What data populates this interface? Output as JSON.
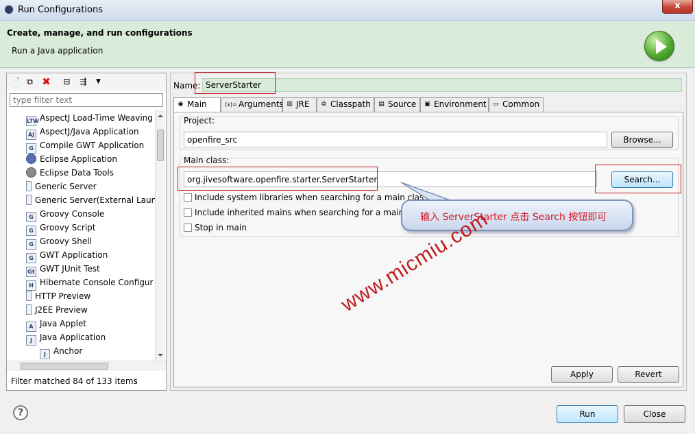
{
  "window": {
    "title": "Run Configurations",
    "close_glyph": "x"
  },
  "banner": {
    "title": "Create, manage, and run configurations",
    "subtitle": "Run a Java application",
    "icon": "run-icon"
  },
  "left": {
    "filter_placeholder": "type filter text",
    "toolbar_icons": [
      "new-config-icon",
      "duplicate-icon",
      "delete-icon",
      "collapse-all-icon",
      "filter-icon",
      "dropdown-icon"
    ],
    "items": [
      {
        "label": "AspectJ Load-Time Weaving",
        "icon": "ltw-icon",
        "badge": "LTW"
      },
      {
        "label": "AspectJ/Java Application",
        "icon": "aj-icon",
        "badge": "AJ"
      },
      {
        "label": "Compile GWT Application",
        "icon": "gwt-compile-icon",
        "badge": "G"
      },
      {
        "label": "Eclipse Application",
        "icon": "eclipse-icon",
        "badge": ""
      },
      {
        "label": "Eclipse Data Tools",
        "icon": "data-tools-icon",
        "badge": ""
      },
      {
        "label": "Generic Server",
        "icon": "server-icon",
        "badge": ""
      },
      {
        "label": "Generic Server(External Laun",
        "icon": "server-icon",
        "badge": ""
      },
      {
        "label": "Groovy Console",
        "icon": "groovy-icon",
        "badge": "G"
      },
      {
        "label": "Groovy Script",
        "icon": "groovy-icon",
        "badge": "G"
      },
      {
        "label": "Groovy Shell",
        "icon": "groovy-icon",
        "badge": "G"
      },
      {
        "label": "GWT Application",
        "icon": "gwt-icon",
        "badge": "G"
      },
      {
        "label": "GWT JUnit Test",
        "icon": "gwt-junit-icon",
        "badge": "Gt"
      },
      {
        "label": "Hibernate Console Configur",
        "icon": "hibernate-icon",
        "badge": "H"
      },
      {
        "label": "HTTP Preview",
        "icon": "server-icon",
        "badge": ""
      },
      {
        "label": "J2EE Preview",
        "icon": "server-icon",
        "badge": ""
      },
      {
        "label": "Java Applet",
        "icon": "applet-icon",
        "badge": "A"
      },
      {
        "label": "Java Application",
        "icon": "java-app-icon",
        "badge": "J"
      },
      {
        "label": "Anchor",
        "icon": "java-config-icon",
        "badge": "J"
      }
    ],
    "status": "Filter matched 84 of 133 items"
  },
  "right": {
    "name_label": "Name:",
    "name_value": "ServerStarter",
    "tabs": [
      {
        "label": "Main",
        "icon": "main-tab-icon",
        "glyph": "◉"
      },
      {
        "label": "Arguments",
        "icon": "arguments-tab-icon",
        "glyph": "(x)="
      },
      {
        "label": "JRE",
        "icon": "jre-tab-icon",
        "glyph": "▥"
      },
      {
        "label": "Classpath",
        "icon": "classpath-tab-icon",
        "glyph": "⧉"
      },
      {
        "label": "Source",
        "icon": "source-tab-icon",
        "glyph": "▤"
      },
      {
        "label": "Environment",
        "icon": "environment-tab-icon",
        "glyph": "▣"
      },
      {
        "label": "Common",
        "icon": "common-tab-icon",
        "glyph": "▭"
      }
    ],
    "project_label": "Project:",
    "project_value": "openfire_src",
    "browse_label": "Browse...",
    "main_class_label": "Main class:",
    "main_class_value": "org.jivesoftware.openfire.starter.ServerStarter",
    "search_label": "Search...",
    "checkboxes": [
      {
        "label": "Include system libraries when searching for a main class",
        "checked": false
      },
      {
        "label": "Include inherited mains when searching for a main class",
        "checked": false
      },
      {
        "label": "Stop in main",
        "checked": false
      }
    ],
    "apply_label": "Apply",
    "revert_label": "Revert"
  },
  "annotation": {
    "callout": "输入 ServerStarter 点击 Search 按钮即可",
    "watermark": "www.micmiu.com",
    "color": "#c0161b"
  },
  "footer": {
    "run_label": "Run",
    "close_label": "Close",
    "help_glyph": "?"
  }
}
